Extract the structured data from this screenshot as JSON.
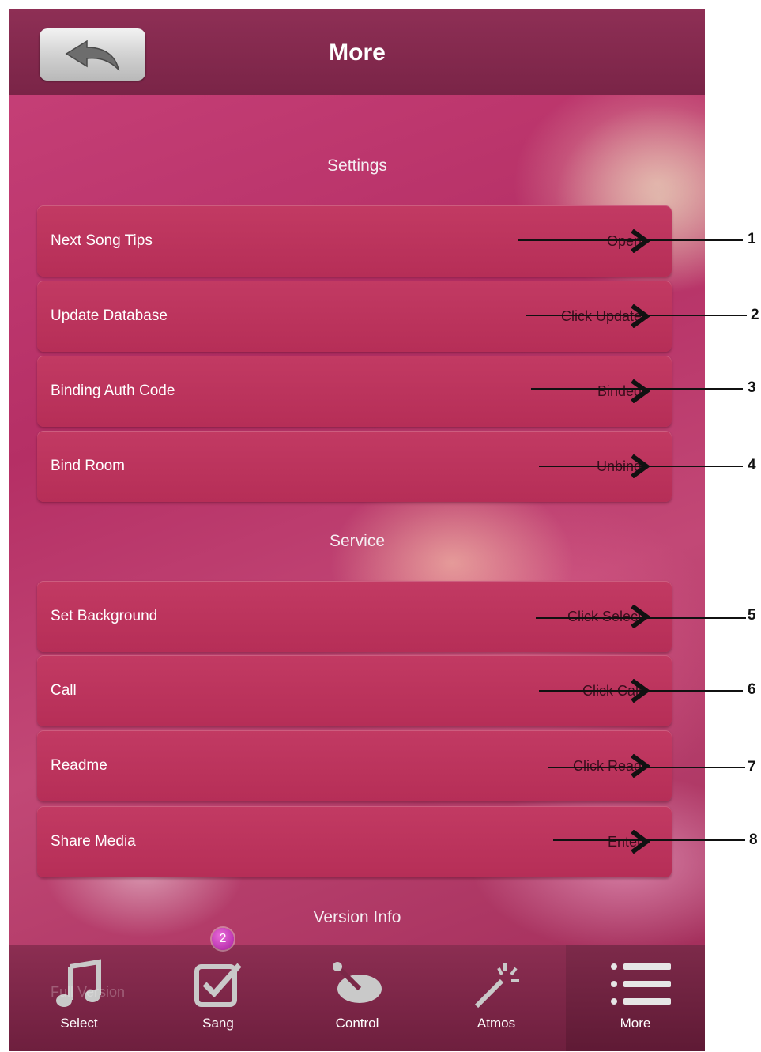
{
  "header": {
    "title": "More",
    "back_icon": "back-arrow-icon"
  },
  "sections": {
    "settings": "Settings",
    "service": "Service",
    "version": "Version Info"
  },
  "settings_rows": [
    {
      "label": "Next Song Tips",
      "value": "Open",
      "callout": "1"
    },
    {
      "label": "Update Database",
      "value": "Click Update",
      "callout": "2"
    },
    {
      "label": "Binding Auth Code",
      "value": "Binded",
      "callout": "3"
    },
    {
      "label": "Bind Room",
      "value": "Unbind",
      "callout": "4"
    }
  ],
  "service_rows": [
    {
      "label": "Set Background",
      "value": "Click Select",
      "callout": "5"
    },
    {
      "label": "Call",
      "value": "Click Call",
      "callout": "6"
    },
    {
      "label": "Readme",
      "value": "Click Read",
      "callout": "7"
    },
    {
      "label": "Share Media",
      "value": "Enter",
      "callout": "8"
    }
  ],
  "tabbar": {
    "tabs": [
      {
        "label": "Select",
        "icon": "music-note-icon"
      },
      {
        "label": "Sang",
        "icon": "checkbox-icon",
        "badge": "2"
      },
      {
        "label": "Control",
        "icon": "control-icon"
      },
      {
        "label": "Atmos",
        "icon": "magic-wand-icon"
      },
      {
        "label": "More",
        "icon": "list-icon",
        "active": true
      }
    ],
    "ghost_text": "Full Version"
  },
  "colors": {
    "row": "#c23a63",
    "topbar": "#8e2f55",
    "tabbar": "#7a2747",
    "badge": "#c33ab8"
  }
}
